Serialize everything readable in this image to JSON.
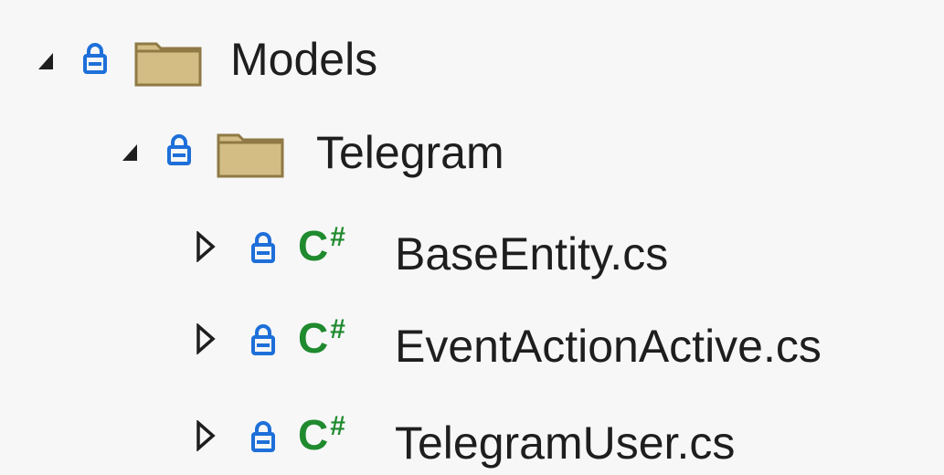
{
  "tree": {
    "items": [
      {
        "label": "Models",
        "kind": "folder",
        "expander": "expanded",
        "depth": 0
      },
      {
        "label": "Telegram",
        "kind": "folder",
        "expander": "expanded",
        "depth": 1
      },
      {
        "label": "BaseEntity.cs",
        "kind": "csharp-file",
        "expander": "collapsed",
        "depth": 2
      },
      {
        "label": "EventActionActive.cs",
        "kind": "csharp-file",
        "expander": "collapsed",
        "depth": 2
      },
      {
        "label": "TelegramUser.cs",
        "kind": "csharp-file",
        "expander": "collapsed",
        "depth": 2
      }
    ]
  },
  "icons": {
    "csharp_letter": "C",
    "csharp_hash": "#",
    "expanded": "triangle-down-right-icon",
    "collapsed": "triangle-right-outline-icon",
    "lock": "lock-icon",
    "folder": "folder-icon"
  },
  "colors": {
    "background": "#f7f7f8",
    "text": "#1e1e1e",
    "lock": "#1e6fd9",
    "csharp": "#1f8a2e",
    "folder_fill": "#d3bd84",
    "folder_stroke": "#8f7a45"
  }
}
